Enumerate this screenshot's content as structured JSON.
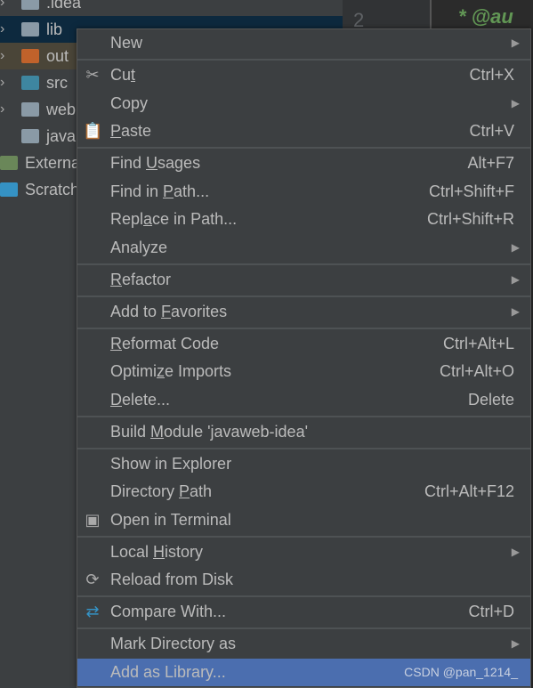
{
  "tree": [
    {
      "label": ".idea",
      "color": "#8a9aa6",
      "expand": true,
      "selected": false
    },
    {
      "label": "lib",
      "color": "#8a9aa6",
      "expand": true,
      "bg": "#0d293e"
    },
    {
      "label": "out",
      "color": "#c0622b",
      "expand": true,
      "bg": "#4a4538"
    },
    {
      "label": "src",
      "color": "#3e86a0",
      "expand": true
    },
    {
      "label": "web",
      "color": "#8a9aa6",
      "expand": true
    },
    {
      "label": "java",
      "color": "#8a9aa6",
      "expand": false,
      "file": true
    },
    {
      "label": "Externa",
      "color": "#6a8759",
      "expand": false,
      "root": true
    },
    {
      "label": "Scratch",
      "color": "#3592c4",
      "expand": false,
      "root": true
    }
  ],
  "gutter": {
    "line": "2"
  },
  "editor": {
    "text": "* @au"
  },
  "menu": [
    {
      "pre": "New",
      "submenu": true
    },
    {
      "sep": true
    },
    {
      "pre": "Cu",
      "key": "t",
      "shortcut": "Ctrl+X",
      "icon": "scissors-icon",
      "glyph": "✂"
    },
    {
      "pre": "Copy",
      "submenu": true
    },
    {
      "key": "P",
      "post": "aste",
      "shortcut": "Ctrl+V",
      "icon": "clipboard-icon",
      "glyph": "📋"
    },
    {
      "sep": true
    },
    {
      "pre": "Find ",
      "key": "U",
      "post": "sages",
      "shortcut": "Alt+F7"
    },
    {
      "pre": "Find in ",
      "key": "P",
      "post": "ath...",
      "shortcut": "Ctrl+Shift+F"
    },
    {
      "pre": "Repl",
      "key": "a",
      "post": "ce in Path...",
      "shortcut": "Ctrl+Shift+R"
    },
    {
      "pre": "Analyze",
      "submenu": true
    },
    {
      "sep": true
    },
    {
      "key": "R",
      "post": "efactor",
      "submenu": true
    },
    {
      "sep": true
    },
    {
      "pre": "Add to ",
      "key": "F",
      "post": "avorites",
      "submenu": true
    },
    {
      "sep": true
    },
    {
      "key": "R",
      "post": "eformat Code",
      "shortcut": "Ctrl+Alt+L"
    },
    {
      "pre": "Optimi",
      "key": "z",
      "post": "e Imports",
      "shortcut": "Ctrl+Alt+O"
    },
    {
      "key": "D",
      "post": "elete...",
      "shortcut": "Delete"
    },
    {
      "sep": true
    },
    {
      "pre": "Build ",
      "key": "M",
      "post": "odule 'javaweb-idea'"
    },
    {
      "sep": true
    },
    {
      "pre": "Show in Explorer"
    },
    {
      "pre": "Directory ",
      "key": "P",
      "post": "ath",
      "shortcut": "Ctrl+Alt+F12"
    },
    {
      "pre": "Open in Terminal",
      "icon": "terminal-icon",
      "glyph": "▣"
    },
    {
      "sep": true
    },
    {
      "pre": "Local ",
      "key": "H",
      "post": "istory",
      "submenu": true
    },
    {
      "pre": "Reload from Disk",
      "icon": "reload-icon",
      "glyph": "⟳"
    },
    {
      "sep": true
    },
    {
      "pre": "Compare With...",
      "shortcut": "Ctrl+D",
      "icon": "compare-icon",
      "glyph": "⇄",
      "iconColor": "#3592c4"
    },
    {
      "sep": true
    },
    {
      "pre": "Mark Directory as",
      "submenu": true
    },
    {
      "pre": "Add as Library...",
      "selected": true,
      "watermark": "CSDN @pan_1214_"
    }
  ],
  "colors": {
    "selection": "#4b6eaf",
    "menu_bg": "#3c3f41"
  }
}
